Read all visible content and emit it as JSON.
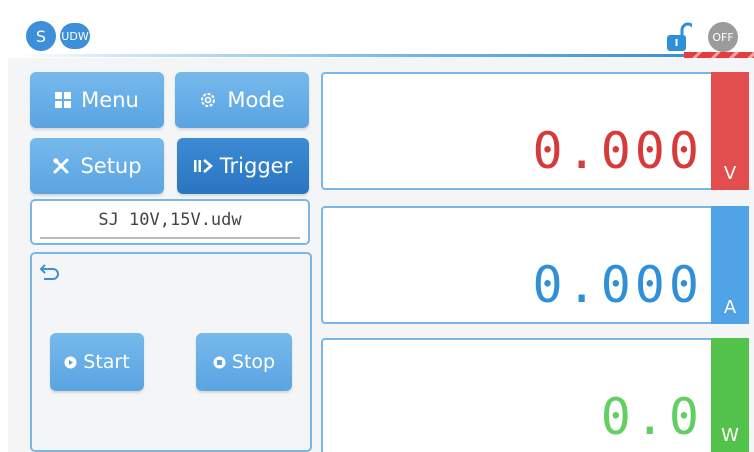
{
  "status": {
    "mode_badge": "S",
    "file_badge": "UDW",
    "output_state": "OFF"
  },
  "buttons": {
    "menu": "Menu",
    "mode": "Mode",
    "setup": "Setup",
    "trigger": "Trigger"
  },
  "file": {
    "name": "SJ 10V,15V.udw"
  },
  "list_controls": {
    "start": "Start",
    "stop": "Stop"
  },
  "meters": [
    {
      "value": "0.000",
      "unit": "V",
      "color": "#d63a3a",
      "unit_bg": "#e24d4d"
    },
    {
      "value": "0.000",
      "unit": "A",
      "color": "#2f8fd8",
      "unit_bg": "#4fa3e6"
    },
    {
      "value": "0.0",
      "unit": "W",
      "color": "#63cf63",
      "unit_bg": "#52c24a"
    }
  ],
  "colors": {
    "accent": "#3d8fd9",
    "lock": "#2f8fd8",
    "off": "#9b9b9b"
  },
  "icons": {
    "menu": "grid-icon",
    "mode": "gear-icon",
    "setup": "tools-icon",
    "trigger": "trigger-icon",
    "back": "back-arrow-icon",
    "lock": "unlock-icon"
  }
}
